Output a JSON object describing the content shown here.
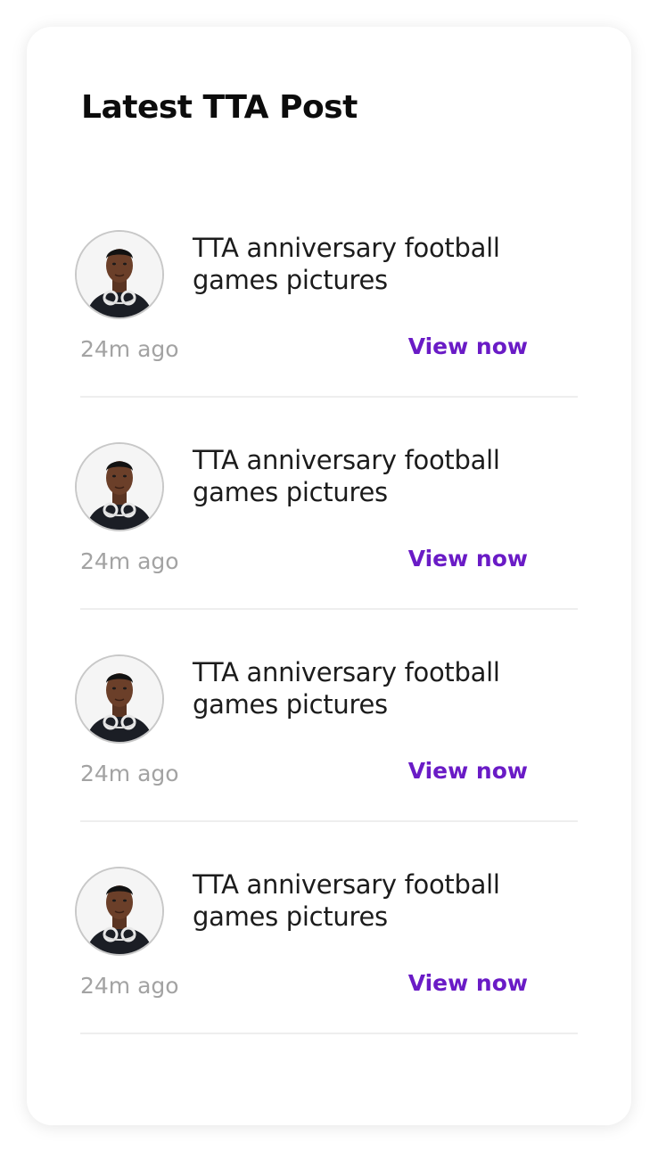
{
  "card": {
    "title": "Latest TTA Post"
  },
  "posts": [
    {
      "avatar_icon": "user-avatar-icon",
      "title": "TTA anniversary football games pictures",
      "time": "24m ago",
      "action_label": "View now"
    },
    {
      "avatar_icon": "user-avatar-icon",
      "title": "TTA anniversary football games pictures",
      "time": "24m ago",
      "action_label": "View now"
    },
    {
      "avatar_icon": "user-avatar-icon",
      "title": "TTA anniversary football games pictures",
      "time": "24m ago",
      "action_label": "View now"
    },
    {
      "avatar_icon": "user-avatar-icon",
      "title": "TTA anniversary football games pictures",
      "time": "24m ago",
      "action_label": "View now"
    }
  ],
  "colors": {
    "accent": "#6a1bc6",
    "title_text": "#1c1c1c",
    "muted_text": "#a3a3a3",
    "divider": "#eeeeee"
  }
}
